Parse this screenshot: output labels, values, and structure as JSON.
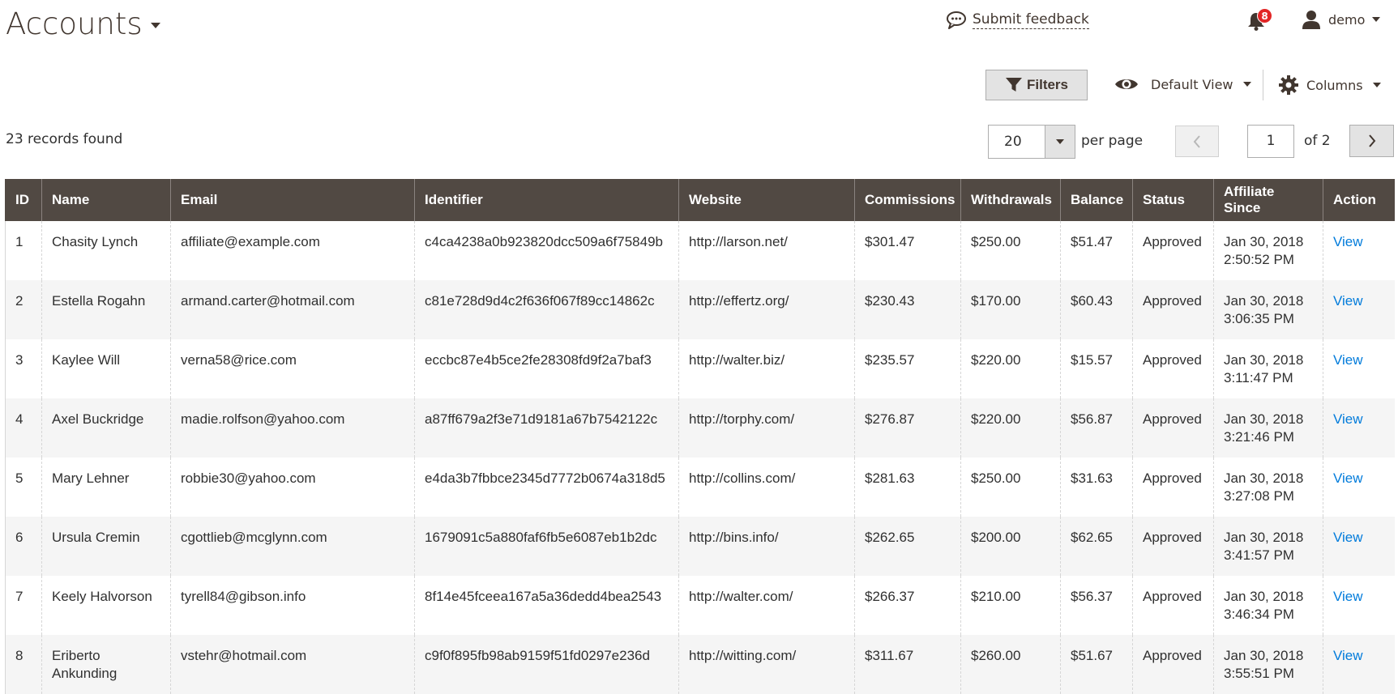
{
  "header": {
    "title": "Accounts",
    "feedback_label": "Submit feedback",
    "notifications_count": "8",
    "user_name": "demo"
  },
  "toolbar": {
    "filters_label": "Filters",
    "view_label": "Default View",
    "columns_label": "Columns",
    "records_found": "23 records found",
    "per_page_value": "20",
    "per_page_label": "per page",
    "page_value": "1",
    "page_of": "of 2"
  },
  "table": {
    "columns": [
      "ID",
      "Name",
      "Email",
      "Identifier",
      "Website",
      "Commissions",
      "Withdrawals",
      "Balance",
      "Status",
      "Affiliate Since",
      "Action"
    ],
    "rows": [
      {
        "id": "1",
        "name": "Chasity Lynch",
        "email": "affiliate@example.com",
        "identifier": "c4ca4238a0b923820dcc509a6f75849b",
        "website": "http://larson.net/",
        "commissions": "$301.47",
        "withdrawals": "$250.00",
        "balance": "$51.47",
        "status": "Approved",
        "since_date": "Jan 30, 2018",
        "since_time": "2:50:52 PM",
        "action": "View"
      },
      {
        "id": "2",
        "name": "Estella Rogahn",
        "email": "armand.carter@hotmail.com",
        "identifier": "c81e728d9d4c2f636f067f89cc14862c",
        "website": "http://effertz.org/",
        "commissions": "$230.43",
        "withdrawals": "$170.00",
        "balance": "$60.43",
        "status": "Approved",
        "since_date": "Jan 30, 2018",
        "since_time": "3:06:35 PM",
        "action": "View"
      },
      {
        "id": "3",
        "name": "Kaylee Will",
        "email": "verna58@rice.com",
        "identifier": "eccbc87e4b5ce2fe28308fd9f2a7baf3",
        "website": "http://walter.biz/",
        "commissions": "$235.57",
        "withdrawals": "$220.00",
        "balance": "$15.57",
        "status": "Approved",
        "since_date": "Jan 30, 2018",
        "since_time": "3:11:47 PM",
        "action": "View"
      },
      {
        "id": "4",
        "name": "Axel Buckridge",
        "email": "madie.rolfson@yahoo.com",
        "identifier": "a87ff679a2f3e71d9181a67b7542122c",
        "website": "http://torphy.com/",
        "commissions": "$276.87",
        "withdrawals": "$220.00",
        "balance": "$56.87",
        "status": "Approved",
        "since_date": "Jan 30, 2018",
        "since_time": "3:21:46 PM",
        "action": "View"
      },
      {
        "id": "5",
        "name": "Mary Lehner",
        "email": "robbie30@yahoo.com",
        "identifier": "e4da3b7fbbce2345d7772b0674a318d5",
        "website": "http://collins.com/",
        "commissions": "$281.63",
        "withdrawals": "$250.00",
        "balance": "$31.63",
        "status": "Approved",
        "since_date": "Jan 30, 2018",
        "since_time": "3:27:08 PM",
        "action": "View"
      },
      {
        "id": "6",
        "name": "Ursula Cremin",
        "email": "cgottlieb@mcglynn.com",
        "identifier": "1679091c5a880faf6fb5e6087eb1b2dc",
        "website": "http://bins.info/",
        "commissions": "$262.65",
        "withdrawals": "$200.00",
        "balance": "$62.65",
        "status": "Approved",
        "since_date": "Jan 30, 2018",
        "since_time": "3:41:57 PM",
        "action": "View"
      },
      {
        "id": "7",
        "name": "Keely Halvorson",
        "email": "tyrell84@gibson.info",
        "identifier": "8f14e45fceea167a5a36dedd4bea2543",
        "website": "http://walter.com/",
        "commissions": "$266.37",
        "withdrawals": "$210.00",
        "balance": "$56.37",
        "status": "Approved",
        "since_date": "Jan 30, 2018",
        "since_time": "3:46:34 PM",
        "action": "View"
      },
      {
        "id": "8",
        "name": "Eriberto Ankunding",
        "email": "vstehr@hotmail.com",
        "identifier": "c9f0f895fb98ab9159f51fd0297e236d",
        "website": "http://witting.com/",
        "commissions": "$311.67",
        "withdrawals": "$260.00",
        "balance": "$51.67",
        "status": "Approved",
        "since_date": "Jan 30, 2018",
        "since_time": "3:55:51 PM",
        "action": "View"
      }
    ]
  }
}
